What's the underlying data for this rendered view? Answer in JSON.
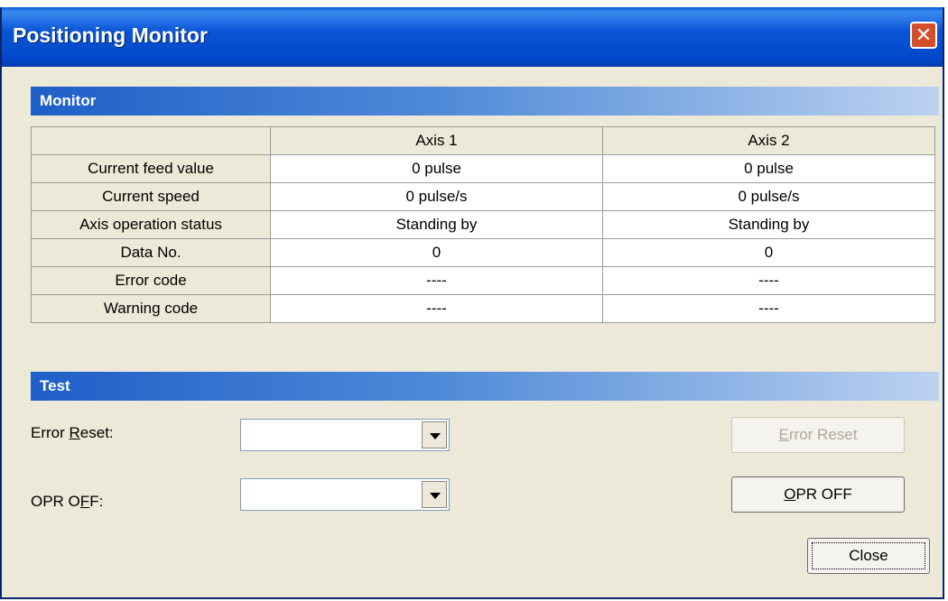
{
  "window": {
    "title": "Positioning Monitor"
  },
  "monitor": {
    "header": "Monitor",
    "columns": [
      "",
      "Axis 1",
      "Axis 2"
    ],
    "rows": [
      {
        "label": "Current feed value",
        "axis1": "0 pulse",
        "axis2": "0 pulse"
      },
      {
        "label": "Current speed",
        "axis1": "0 pulse/s",
        "axis2": "0 pulse/s"
      },
      {
        "label": "Axis operation status",
        "axis1": "Standing by",
        "axis2": "Standing by"
      },
      {
        "label": "Data No.",
        "axis1": "0",
        "axis2": "0"
      },
      {
        "label": "Error code",
        "axis1": "----",
        "axis2": "----"
      },
      {
        "label": "Warning code",
        "axis1": "----",
        "axis2": "----"
      }
    ]
  },
  "test": {
    "header": "Test",
    "error_reset_label_a": "Error ",
    "error_reset_label_u": "R",
    "error_reset_label_b": "eset:",
    "error_reset_value": "",
    "opr_off_label_a": "OPR O",
    "opr_off_label_u": "F",
    "opr_off_label_b": "F:",
    "opr_off_value": "",
    "error_reset_button_u": "E",
    "error_reset_button_rest": "rror Reset",
    "opr_off_button_u": "O",
    "opr_off_button_rest": "PR OFF",
    "close_button": "Close"
  },
  "icons": {
    "close": "close-icon",
    "dropdown": "chevron-down-icon"
  }
}
